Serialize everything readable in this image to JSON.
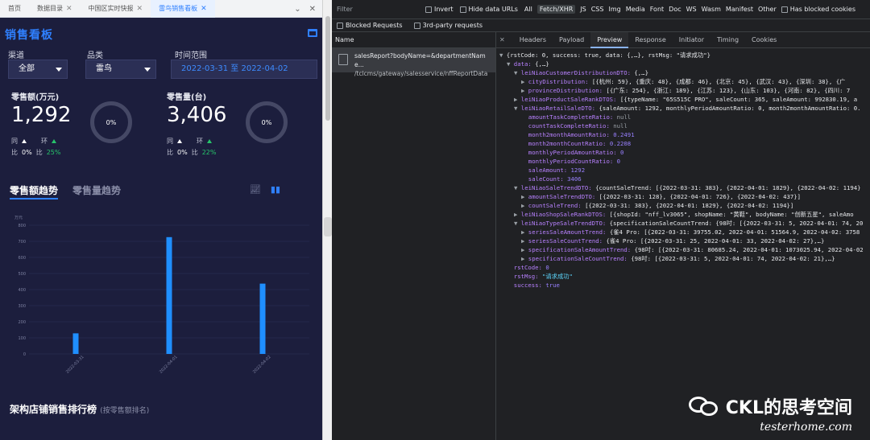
{
  "tabs": [
    {
      "label": "首页",
      "closable": false,
      "active": false
    },
    {
      "label": "数据目录",
      "closable": true,
      "active": false
    },
    {
      "label": "中国区实时快报",
      "closable": true,
      "active": false
    },
    {
      "label": "雷鸟销售看板",
      "closable": true,
      "active": true
    }
  ],
  "app": {
    "title": "销售看板",
    "filters": {
      "channel_label": "渠道",
      "channel_value": "全部",
      "category_label": "品类",
      "category_value": "雷鸟",
      "time_label": "时间范围",
      "time_value": "2022-03-31 至 2022-04-02"
    },
    "kpis": [
      {
        "label": "零售额(万元)",
        "value": "1,292",
        "ring": "0%",
        "yoy_label_top": "同",
        "yoy_label_bottom": "比",
        "yoy_value": "0%",
        "mom_label_top": "环",
        "mom_label_bottom": "比",
        "mom_value": "25%"
      },
      {
        "label": "零售量(台)",
        "value": "3,406",
        "ring": "0%",
        "yoy_label_top": "同",
        "yoy_label_bottom": "比",
        "yoy_value": "0%",
        "mom_label_top": "环",
        "mom_label_bottom": "比",
        "mom_value": "22%"
      }
    ],
    "trend_tabs": [
      "零售额趋势",
      "零售量趋势"
    ],
    "rank_title": "架构店铺销售排行榜",
    "rank_sub": "(按零售额排名)"
  },
  "chart_data": {
    "type": "bar",
    "categories": [
      "2022-03-31",
      "2022-04-01",
      "2022-04-02"
    ],
    "values": [
      128,
      726,
      437
    ],
    "ylabel": "万元",
    "ylim": [
      0,
      800
    ],
    "yticks": [
      0,
      100,
      200,
      300,
      400,
      500,
      600,
      700,
      800
    ],
    "grid": true,
    "color": "#1f8fff"
  },
  "devtools": {
    "filter_placeholder": "Filter",
    "options": [
      "Invert",
      "Hide data URLs",
      "All"
    ],
    "types": [
      "Fetch/XHR",
      "JS",
      "CSS",
      "Img",
      "Media",
      "Font",
      "Doc",
      "WS",
      "Wasm",
      "Manifest",
      "Other"
    ],
    "has_blocked": "Has blocked cookies",
    "blocked_requests": "Blocked Requests",
    "third_party": "3rd-party requests",
    "name_header": "Name",
    "request_name": "salesReport?bodyName=&departmentName...",
    "request_path": "/tclcms/gateway/salesservice/nffReportData",
    "detail_tabs": [
      "Headers",
      "Payload",
      "Preview",
      "Response",
      "Initiator",
      "Timing",
      "Cookies"
    ],
    "json_lines": [
      {
        "indent": 0,
        "tri": "▼",
        "text": "{rstCode: 0, success: true, data: {,…}, rstMsg: \"请求成功\"}",
        "type": "plain"
      },
      {
        "indent": 1,
        "tri": "▼",
        "key": "data",
        "text": "{,…}",
        "type": "kv"
      },
      {
        "indent": 2,
        "tri": "▼",
        "key": "leiNiaoCustomerDistributionDTO",
        "text": "{,…}",
        "type": "kv"
      },
      {
        "indent": 3,
        "tri": "▶",
        "key": "cityDistribution",
        "text": "[{杭州: 59}, {重庆: 48}, {成都: 46}, {北京: 45}, {武汉: 43}, {深圳: 38}, {广",
        "type": "kv"
      },
      {
        "indent": 3,
        "tri": "▶",
        "key": "provinceDistribution",
        "text": "[{广东: 254}, {浙江: 189}, {江苏: 123}, {山东: 103}, {河南: 82}, {四川: 7",
        "type": "kv"
      },
      {
        "indent": 2,
        "tri": "▶",
        "key": "leiNiaoProductSaleRankDTOS",
        "text": "[{typeName: \"65S515C PRO\", saleCount: 365, saleAmount: 992830.19, a",
        "type": "kv"
      },
      {
        "indent": 2,
        "tri": "▼",
        "key": "leiNiaoRetailSaleDTO",
        "text": "{saleAmount: 1292, monthlyPeriodAmountRatio: 0, month2monthAmountRatio: 0.",
        "type": "kv"
      },
      {
        "indent": 3,
        "tri": "",
        "key": "amountTaskCompleteRatio",
        "text": "null",
        "type": "null"
      },
      {
        "indent": 3,
        "tri": "",
        "key": "countTaskCompleteRatio",
        "text": "null",
        "type": "null"
      },
      {
        "indent": 3,
        "tri": "",
        "key": "month2monthAmountRatio",
        "text": "0.2491",
        "type": "num"
      },
      {
        "indent": 3,
        "tri": "",
        "key": "month2monthCountRatio",
        "text": "0.2208",
        "type": "num"
      },
      {
        "indent": 3,
        "tri": "",
        "key": "monthlyPeriodAmountRatio",
        "text": "0",
        "type": "num"
      },
      {
        "indent": 3,
        "tri": "",
        "key": "monthlyPeriodCountRatio",
        "text": "0",
        "type": "num"
      },
      {
        "indent": 3,
        "tri": "",
        "key": "saleAmount",
        "text": "1292",
        "type": "num"
      },
      {
        "indent": 3,
        "tri": "",
        "key": "saleCount",
        "text": "3406",
        "type": "num"
      },
      {
        "indent": 2,
        "tri": "▼",
        "key": "leiNiaoSaleTrendDTO",
        "text": "{countSaleTrend: [{2022-03-31: 383}, {2022-04-01: 1829}, {2022-04-02: 1194}",
        "type": "kv"
      },
      {
        "indent": 3,
        "tri": "▶",
        "key": "amountSaleTrendDTO",
        "text": "[{2022-03-31: 128}, {2022-04-01: 726}, {2022-04-02: 437}]",
        "type": "kv"
      },
      {
        "indent": 3,
        "tri": "▶",
        "key": "countSaleTrend",
        "text": "[{2022-03-31: 383}, {2022-04-01: 1829}, {2022-04-02: 1194}]",
        "type": "kv"
      },
      {
        "indent": 2,
        "tri": "▶",
        "key": "leiNiaoShopSaleRankDTOS",
        "text": "[{shopId: \"nff_lv3065\", shopName: \"黄鞋\", bodyName: \"创新五星\", saleAmo",
        "type": "kv"
      },
      {
        "indent": 2,
        "tri": "▼",
        "key": "leiNiaoTypeSaleTrendDTO",
        "text": "{specificationSaleCountTrend: {98吋: [{2022-03-31: 5, 2022-04-01: 74, 20",
        "type": "kv"
      },
      {
        "indent": 3,
        "tri": "▶",
        "key": "seriesSaleAmountTrend",
        "text": "{雀4 Pro: [{2022-03-31: 39755.02, 2022-04-01: 51564.9, 2022-04-02: 3758",
        "type": "kv"
      },
      {
        "indent": 3,
        "tri": "▶",
        "key": "seriesSaleCountTrend",
        "text": "{雀4 Pro: [{2022-03-31: 25, 2022-04-01: 33, 2022-04-02: 27},…}",
        "type": "kv"
      },
      {
        "indent": 3,
        "tri": "▶",
        "key": "specificationSaleAmountTrend",
        "text": "{98吋: [{2022-03-31: 80685.24, 2022-04-01: 1073025.94, 2022-04-02",
        "type": "kv"
      },
      {
        "indent": 3,
        "tri": "▶",
        "key": "specificationSaleCountTrend",
        "text": "{98吋: [{2022-03-31: 5, 2022-04-01: 74, 2022-04-02: 21},…}",
        "type": "kv"
      },
      {
        "indent": 1,
        "tri": "",
        "key": "rstCode",
        "text": "0",
        "type": "num"
      },
      {
        "indent": 1,
        "tri": "",
        "key": "rstMsg",
        "text": "\"请求成功\"",
        "type": "str"
      },
      {
        "indent": 1,
        "tri": "",
        "key": "success",
        "text": "true",
        "type": "bool"
      }
    ]
  },
  "watermark": {
    "title": "CKL的思考空间",
    "sub": "testerhome.com"
  }
}
